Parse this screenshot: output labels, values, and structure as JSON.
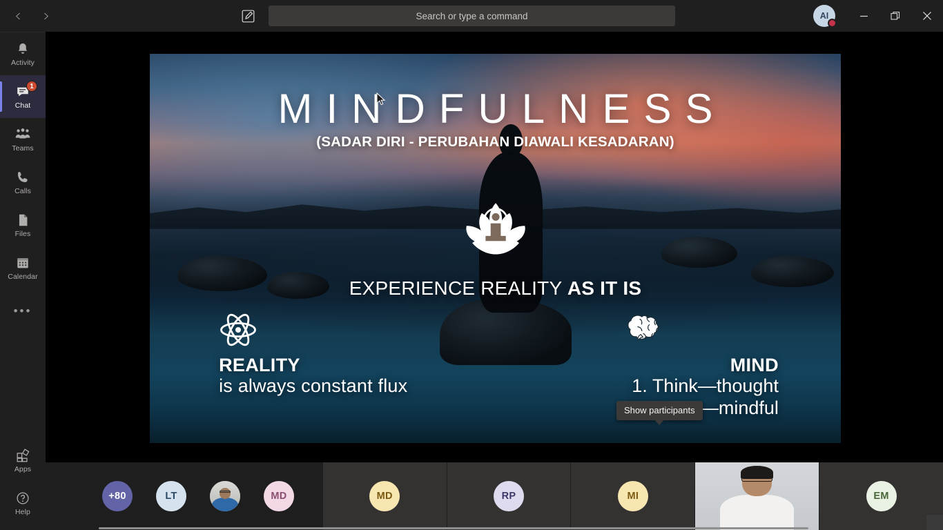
{
  "titlebar": {
    "back_label": "‹",
    "forward_label": "›",
    "compose_icon": "compose-icon",
    "search": {
      "placeholder": "Search or type a command",
      "value": ""
    },
    "avatar": {
      "initials": "AI",
      "presence": "busy",
      "presence_color": "#c4314b"
    },
    "window_controls": {
      "minimize": "—",
      "maximize": "❐",
      "close": "✕"
    }
  },
  "rail": {
    "items": [
      {
        "label": "Activity",
        "icon": "bell-icon",
        "badge": "",
        "active": false
      },
      {
        "label": "Chat",
        "icon": "chat-icon",
        "badge": "1",
        "active": true
      },
      {
        "label": "Teams",
        "icon": "teams-icon",
        "badge": "",
        "active": false
      },
      {
        "label": "Calls",
        "icon": "phone-icon",
        "badge": "",
        "active": false
      },
      {
        "label": "Files",
        "icon": "files-icon",
        "badge": "",
        "active": false
      },
      {
        "label": "Calendar",
        "icon": "calendar-icon",
        "badge": "",
        "active": false
      }
    ],
    "more_label": "•••",
    "bottom": [
      {
        "label": "Apps",
        "icon": "apps-icon"
      },
      {
        "label": "Help",
        "icon": "help-icon"
      }
    ]
  },
  "slide": {
    "title": "MINDFULNESS",
    "subtitle": "(SADAR DIRI - PERUBAHAN DIAWALI KESADARAN)",
    "lotus_icon": "lotus-meditation-icon",
    "tagline_regular": "EXPERIENCE REALITY ",
    "tagline_bold": "AS IT IS",
    "left_column": {
      "icon": "atom-icon",
      "heading": "REALITY",
      "text": "is always constant flux"
    },
    "right_column": {
      "icon": "brain-icon",
      "heading": "MIND",
      "items": [
        "1. Think—thought",
        "2.  Aware—mindful"
      ]
    }
  },
  "tooltip": {
    "text": "Show participants"
  },
  "participants": {
    "overflow": {
      "label": "+80",
      "bg": "#6264a7",
      "fg": "#ffffff"
    },
    "pinned": [
      {
        "label": "LT",
        "bg": "#d6e3ef",
        "fg": "#2b4a66",
        "type": "initials"
      },
      {
        "label": "",
        "bg": "#9aa0a6",
        "fg": "#ffffff",
        "type": "photo"
      },
      {
        "label": "MD",
        "bg": "#f3d9e6",
        "fg": "#8a4f70",
        "type": "initials"
      }
    ],
    "tiles": [
      {
        "label": "MD",
        "bg": "#f8e6b0",
        "fg": "#7a5a12",
        "type": "initials"
      },
      {
        "label": "RP",
        "bg": "#dedbef",
        "fg": "#3b3a6b",
        "type": "initials"
      },
      {
        "label": "MI",
        "bg": "#f8e6b0",
        "fg": "#7a5a12",
        "type": "initials"
      },
      {
        "label": "",
        "bg": "#000000",
        "fg": "#ffffff",
        "type": "video"
      },
      {
        "label": "EM",
        "bg": "#eaf2e4",
        "fg": "#47663a",
        "type": "initials"
      }
    ]
  },
  "colors": {
    "accent": "#6264a7",
    "rail_active": "#2d2c3e",
    "badge": "#cc4a31",
    "presence_busy": "#c4314b",
    "chrome": "#201f1f",
    "tile": "#333231"
  }
}
